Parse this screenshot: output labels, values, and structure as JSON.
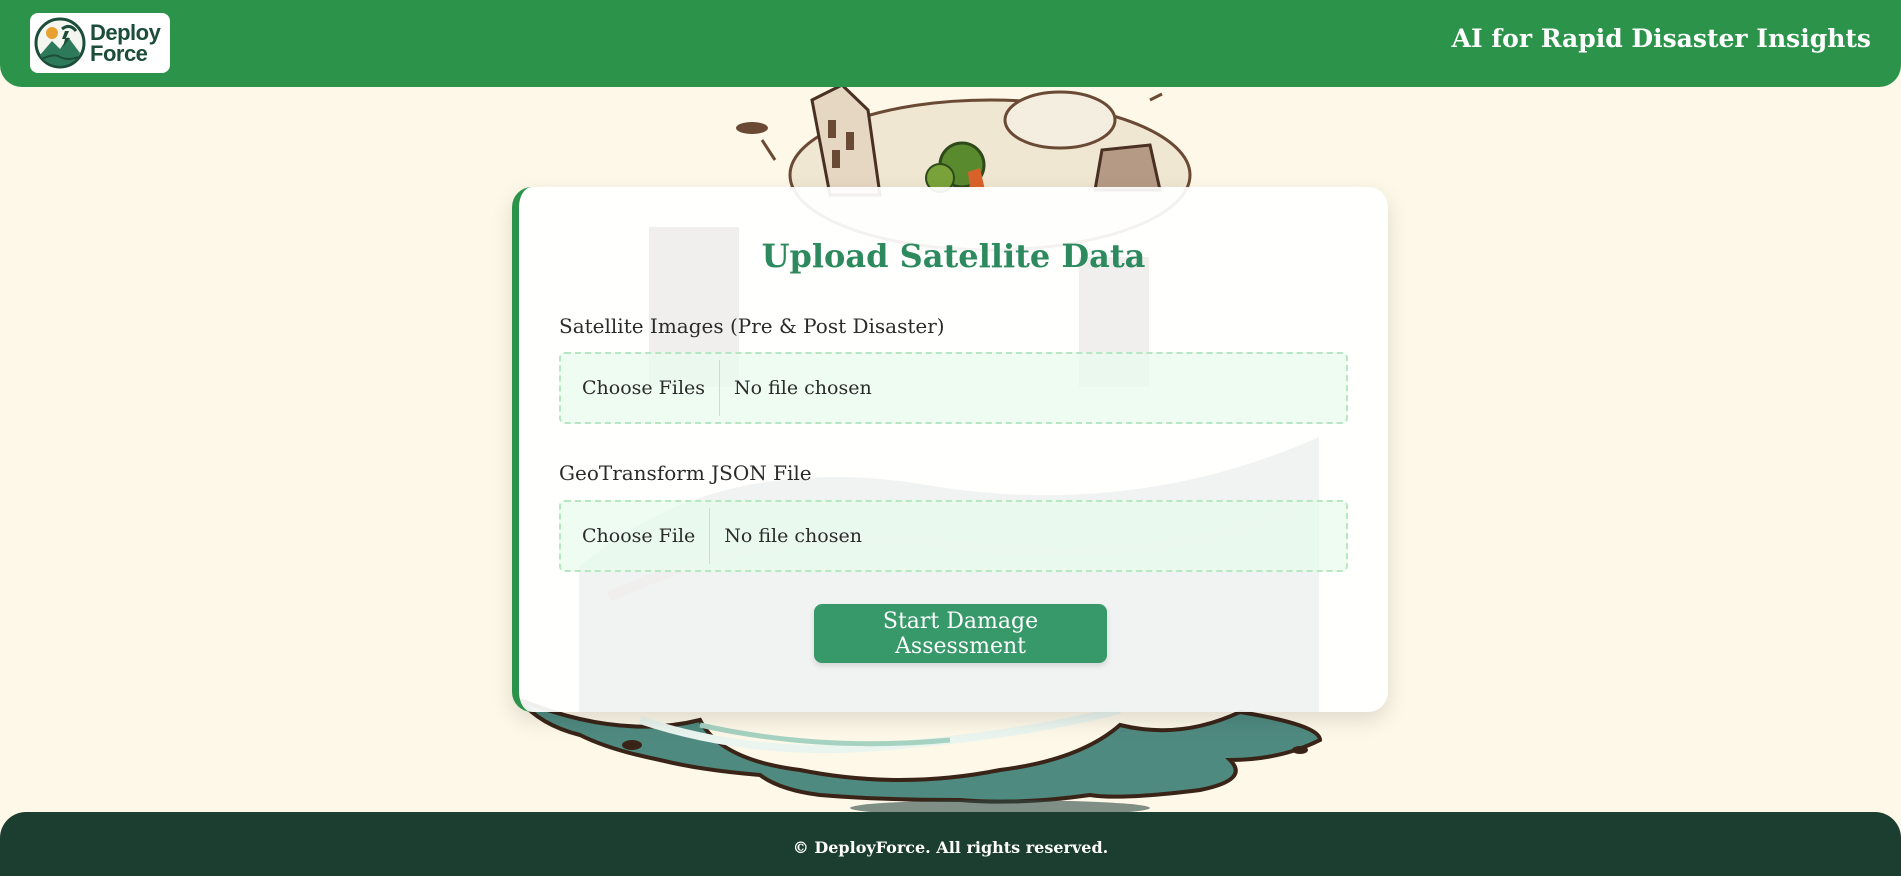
{
  "header": {
    "logo_line1": "Deploy",
    "logo_line2": "Force",
    "tagline": "AI for Rapid Disaster Insights"
  },
  "form": {
    "title": "Upload Satellite Data",
    "fields": [
      {
        "label": "Satellite Images (Pre & Post Disaster)",
        "button_label": "Choose Files",
        "status": "No file chosen"
      },
      {
        "label": "GeoTransform JSON File",
        "button_label": "Choose File",
        "status": "No file chosen"
      }
    ],
    "submit_label": "Start Damage Assessment"
  },
  "footer": {
    "copyright": "© DeployForce. All rights reserved."
  },
  "colors": {
    "header_bg": "#2c944a",
    "footer_bg": "#1c3e30",
    "accent_title": "#2c8a5e",
    "button_bg": "#37996a",
    "page_bg": "#fdf8e8",
    "dropzone_bg": "#e8fbec"
  },
  "icons": [
    "deployforce-logo-icon",
    "background-illustration"
  ]
}
